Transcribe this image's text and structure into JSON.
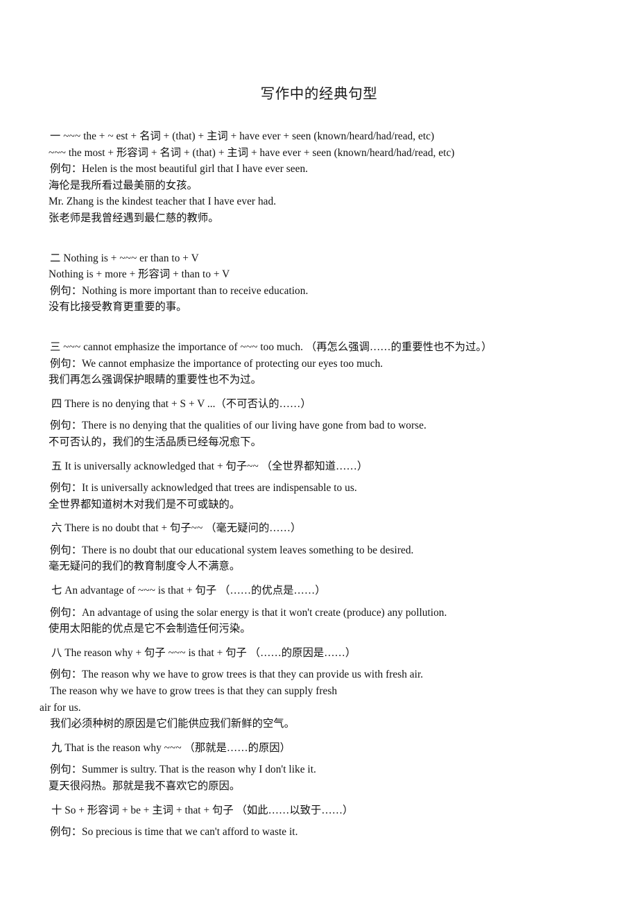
{
  "document": {
    "title": "写作中的经典句型",
    "background_color": "#ffffff",
    "text_color": "#111111"
  },
  "sections": [
    {
      "marker": "一",
      "lines": [
        "一  ~~~ the + ~ est +  名词  + (that) +  主词  + have ever + seen (known/heard/had/read, etc)",
        "~~~ the most +  形容词  +  名词  + (that) +  主词  + have ever + seen (known/heard/had/read, etc)",
        "例句：Helen is the most beautiful girl that I have ever seen.",
        "海伦是我所看过最美丽的女孩。",
        "Mr. Zhang is the kindest teacher that I have ever had.",
        "张老师是我曾经遇到最仁慈的教师。"
      ]
    },
    {
      "marker": "二",
      "lines": [
        "二  Nothing is + ~~~ er than to + V",
        "Nothing is + more +  形容词  + than to + V",
        "例句：Nothing is more important than to receive education.",
        "没有比接受教育更重要的事。"
      ]
    },
    {
      "marker": "三",
      "lines": [
        "三  ~~~ cannot emphasize the importance of ~~~ too much. （再怎么强调……的重要性也不为过。）",
        "例句：We cannot emphasize the importance of protecting our eyes too much.",
        "我们再怎么强调保护眼睛的重要性也不为过。"
      ]
    },
    {
      "marker": "四",
      "lines": [
        "四  There is no denying that + S + V ...（不可否认的……）",
        "例句：There is no denying that the qualities of our living have gone from bad to worse.",
        "不可否认的，我们的生活品质已经每况愈下。"
      ]
    },
    {
      "marker": "五",
      "lines": [
        "五  It is universally acknowledged that +  句子~~  （全世界都知道……）",
        "例句：It is universally acknowledged that trees are indispensable to us.",
        "全世界都知道树木对我们是不可或缺的。"
      ]
    },
    {
      "marker": "六",
      "lines": [
        "六  There is no doubt that +  句子~~  （毫无疑问的……）",
        "例句：There is no doubt that our educational system leaves something to be desired.",
        "毫无疑问的我们的教育制度令人不满意。"
      ]
    },
    {
      "marker": "七",
      "lines": [
        "七  An advantage of ~~~ is that +  句子  （……的优点是……）",
        "例句：An advantage of using the solar energy is that it won't create (produce) any pollution.",
        "使用太阳能的优点是它不会制造任何污染。"
      ]
    },
    {
      "marker": "八",
      "lines": [
        "八  The reason why +  句子  ~~~ is that +  句子  （……的原因是……）",
        "例句：The reason why we have to grow trees is that they can provide us with fresh air.",
        "The reason why we have to grow trees is that they can supply fresh",
        "air for us.",
        "我们必须种树的原因是它们能供应我们新鲜的空气。"
      ]
    },
    {
      "marker": "九",
      "lines": [
        "九  That is the reason why ~~~  （那就是……的原因）",
        "例句：Summer is sultry. That is the reason why I don't like it.",
        "夏天很闷热。那就是我不喜欢它的原因。"
      ]
    },
    {
      "marker": "十",
      "lines": [
        "十  So +  形容词  + be +  主词  + that +  句子  （如此……以致于……）",
        "例句：So precious is time that we can't afford to waste it."
      ]
    }
  ]
}
